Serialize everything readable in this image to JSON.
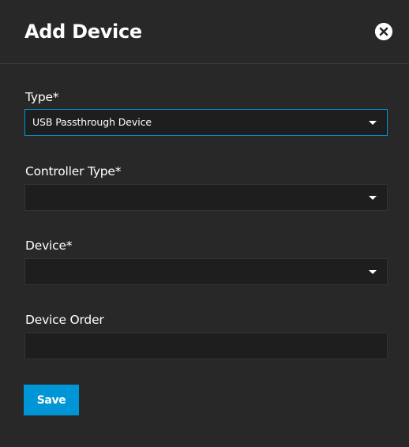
{
  "dialog": {
    "title": "Add Device",
    "close_icon": "close-circle-icon"
  },
  "form": {
    "type": {
      "label": "Type*",
      "value": "USB Passthrough Device"
    },
    "controller_type": {
      "label": "Controller Type*",
      "value": ""
    },
    "device": {
      "label": "Device*",
      "value": ""
    },
    "device_order": {
      "label": "Device Order",
      "value": ""
    }
  },
  "actions": {
    "save_label": "Save"
  },
  "colors": {
    "background": "#282828",
    "field_background": "#1e1e1e",
    "accent": "#0095d5",
    "text": "#ffffff"
  }
}
